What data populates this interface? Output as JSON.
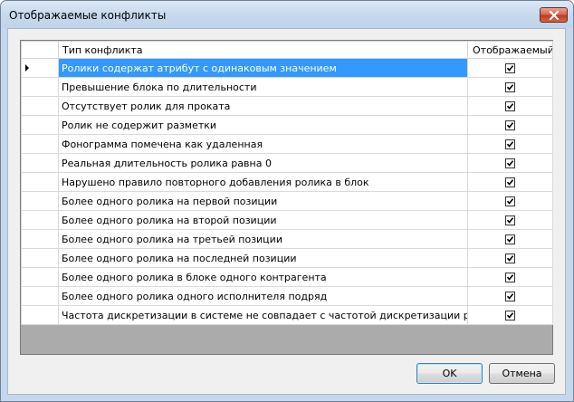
{
  "window": {
    "title": "Отображаемые конфликты"
  },
  "grid": {
    "columns": [
      "Тип конфликта",
      "Отображаемый"
    ],
    "rows": [
      {
        "name": "Ролики содержат атрибут с одинаковым значением",
        "checked": true,
        "selected": true
      },
      {
        "name": "Превышение блока по длительности",
        "checked": true
      },
      {
        "name": "Отсутствует ролик для проката",
        "checked": true
      },
      {
        "name": "Ролик не содержит разметки",
        "checked": true
      },
      {
        "name": "Фонограмма помечена как удаленная",
        "checked": true
      },
      {
        "name": "Реальная длительность ролика равна 0",
        "checked": true
      },
      {
        "name": "Нарушено правило повторного добавления ролика в блок",
        "checked": true
      },
      {
        "name": "Более одного ролика на первой позиции",
        "checked": true
      },
      {
        "name": "Более одного ролика на второй позиции",
        "checked": true
      },
      {
        "name": "Более одного ролика на третьей позиции",
        "checked": true
      },
      {
        "name": "Более одного ролика на последней позиции",
        "checked": true
      },
      {
        "name": "Более одного ролика в блоке одного контрагента",
        "checked": true
      },
      {
        "name": "Более одного ролика одного исполнителя подряд",
        "checked": true
      },
      {
        "name": "Частота дискретизации в системе не совпадает с частотой дискретизации ролика",
        "checked": true
      }
    ]
  },
  "buttons": {
    "ok": "OK",
    "cancel": "Отмена"
  },
  "colors": {
    "selection": "#3399ff",
    "titlebar": "#c6d8ed",
    "close": "#c23b1d"
  }
}
